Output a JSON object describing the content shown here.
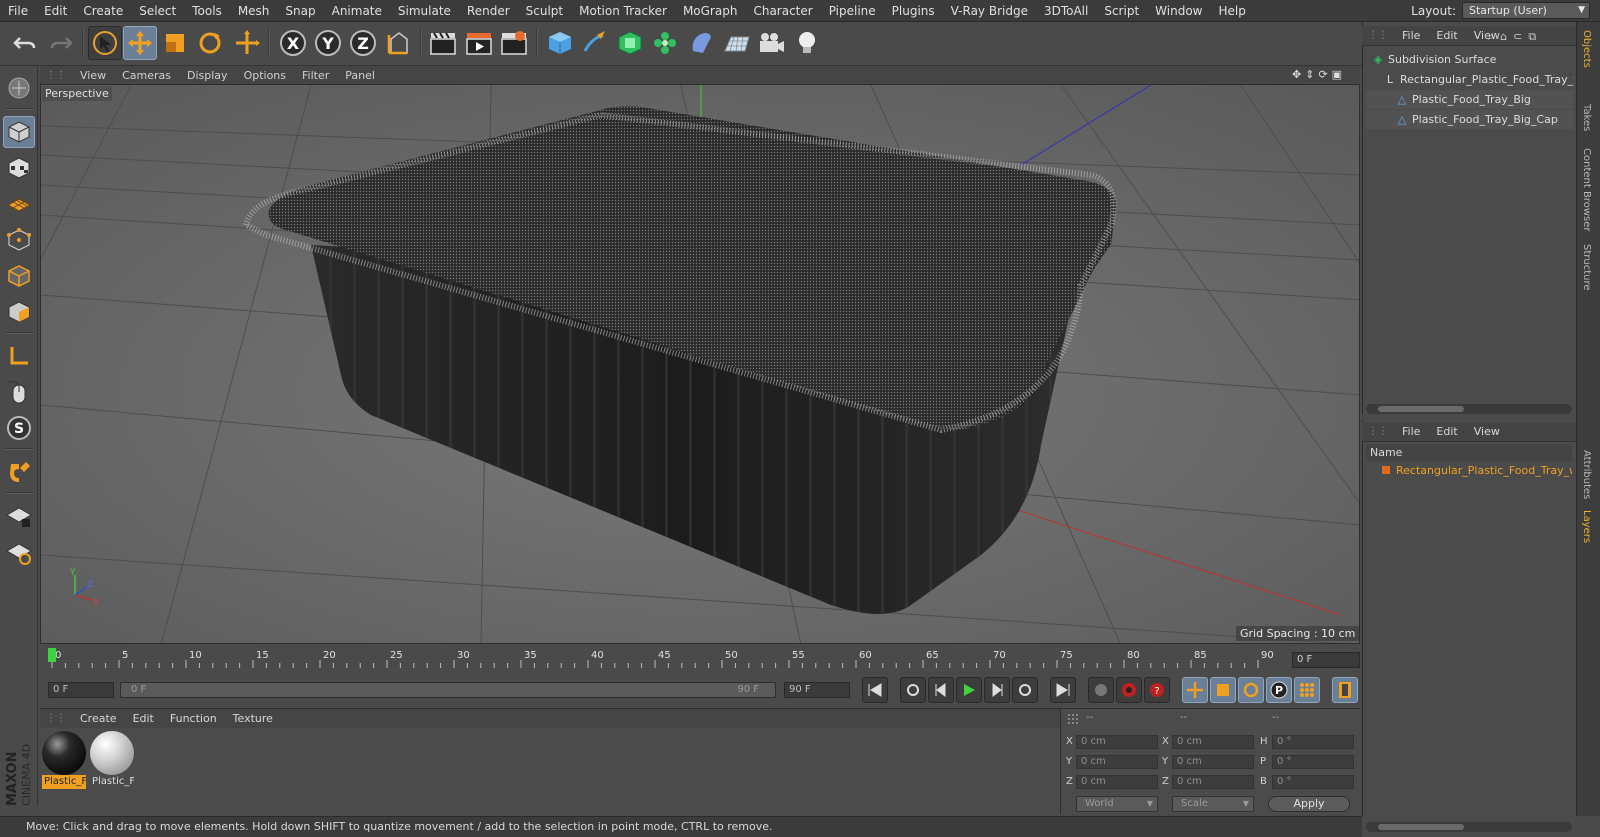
{
  "menu": [
    "File",
    "Edit",
    "Create",
    "Select",
    "Tools",
    "Mesh",
    "Snap",
    "Animate",
    "Simulate",
    "Render",
    "Sculpt",
    "Motion Tracker",
    "MoGraph",
    "Character",
    "Pipeline",
    "Plugins",
    "V-Ray Bridge",
    "3DToAll",
    "Script",
    "Window",
    "Help"
  ],
  "layout": {
    "label": "Layout:",
    "value": "Startup (User)"
  },
  "viewport": {
    "menu": [
      "View",
      "Cameras",
      "Display",
      "Options",
      "Filter",
      "Panel"
    ],
    "label": "Perspective",
    "grid_spacing": "Grid Spacing : 10 cm",
    "axis_labels": {
      "x": "X",
      "y": "Y",
      "z": "Z"
    }
  },
  "timeline": {
    "ticks": [
      "0",
      "5",
      "10",
      "15",
      "20",
      "25",
      "30",
      "35",
      "40",
      "45",
      "50",
      "55",
      "60",
      "65",
      "70",
      "75",
      "80",
      "85",
      "90"
    ],
    "current_frame": "0 F"
  },
  "playback": {
    "start": "0 F",
    "range_start": "0 F",
    "range_end": "90 F",
    "end": "90 F"
  },
  "materials": {
    "menu": [
      "Create",
      "Edit",
      "Function",
      "Texture"
    ],
    "items": [
      {
        "label": "Plastic_F",
        "color": "#1a1a1a",
        "selected": true
      },
      {
        "label": "Plastic_F",
        "color": "#d8d8d8",
        "selected": false
      }
    ],
    "brand_top": "MAXON",
    "brand_bottom": "CINEMA 4D"
  },
  "coordinates": {
    "headers": [
      "--",
      "--",
      "--"
    ],
    "rows": [
      {
        "a": "X",
        "a_val": "0 cm",
        "b": "X",
        "b_val": "0 cm",
        "c": "H",
        "c_val": "0 °"
      },
      {
        "a": "Y",
        "a_val": "0 cm",
        "b": "Y",
        "b_val": "0 cm",
        "c": "P",
        "c_val": "0 °"
      },
      {
        "a": "Z",
        "a_val": "0 cm",
        "b": "Z",
        "b_val": "0 cm",
        "c": "B",
        "c_val": "0 °"
      }
    ],
    "mode": "World",
    "type": "Scale",
    "apply": "Apply"
  },
  "objects": {
    "menu": [
      "File",
      "Edit",
      "View"
    ],
    "tree": [
      {
        "name": "Subdivision Surface",
        "indent": 0,
        "icon": "subdivision-icon"
      },
      {
        "name": "Rectangular_Plastic_Food_Tray_v",
        "indent": 1,
        "icon": "null-icon"
      },
      {
        "name": "Plastic_Food_Tray_Big",
        "indent": 2,
        "icon": "polygon-icon"
      },
      {
        "name": "Plastic_Food_Tray_Big_Cap",
        "indent": 2,
        "icon": "polygon-icon"
      }
    ]
  },
  "layers": {
    "menu": [
      "File",
      "Edit",
      "View"
    ],
    "column": "Name",
    "items": [
      {
        "name": "Rectangular_Plastic_Food_Tray_wi",
        "color": "#e06a1e"
      }
    ]
  },
  "side_tabs": {
    "top": [
      "Objects",
      "Takes",
      "Content Browser",
      "Structure"
    ],
    "bottom": [
      "Attributes",
      "Layers"
    ]
  },
  "status": "Move: Click and drag to move elements. Hold down SHIFT to quantize movement / add to the selection in point mode, CTRL to remove.",
  "colors": {
    "accent": "#f0a020",
    "selection": "#6b7f96",
    "playhead": "#3fd23f"
  }
}
